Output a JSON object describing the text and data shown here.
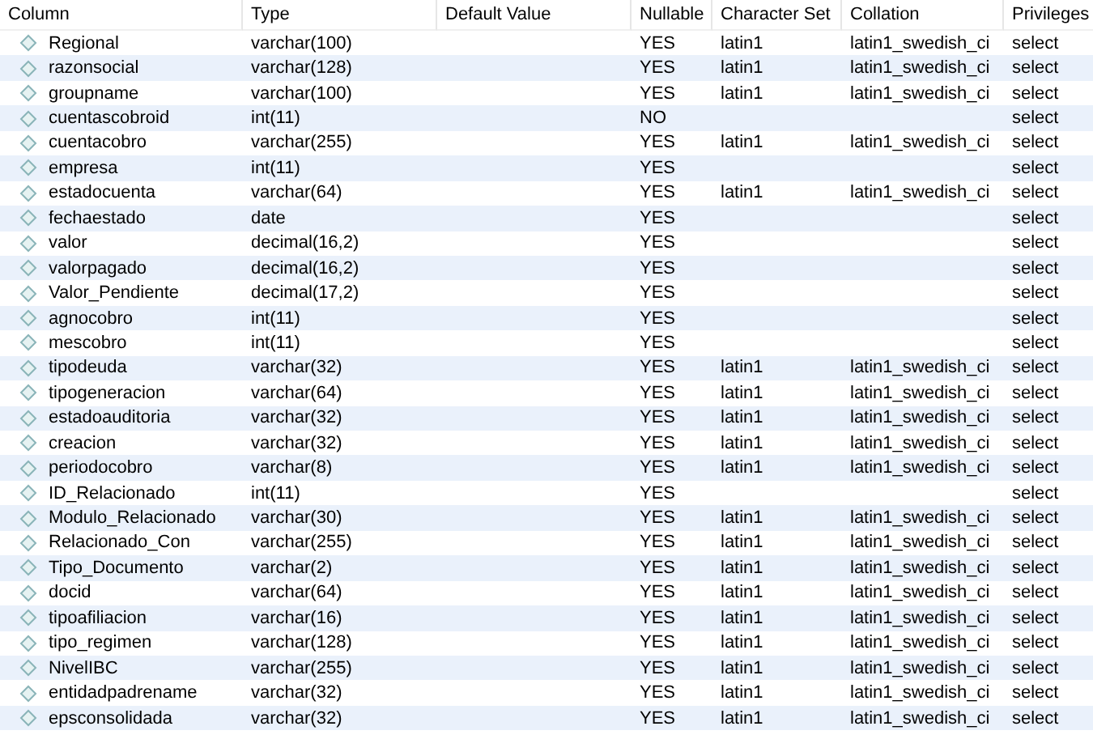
{
  "table": {
    "columns": [
      "Column",
      "Type",
      "Default Value",
      "Nullable",
      "Character Set",
      "Collation",
      "Privileges"
    ],
    "rows": [
      {
        "column": "Regional",
        "type": "varchar(100)",
        "nullable": "YES",
        "charset": "latin1",
        "collation": "latin1_swedish_ci",
        "privileges": "select"
      },
      {
        "column": "razonsocial",
        "type": "varchar(128)",
        "nullable": "YES",
        "charset": "latin1",
        "collation": "latin1_swedish_ci",
        "privileges": "select"
      },
      {
        "column": "groupname",
        "type": "varchar(100)",
        "nullable": "YES",
        "charset": "latin1",
        "collation": "latin1_swedish_ci",
        "privileges": "select"
      },
      {
        "column": "cuentascobroid",
        "type": "int(11)",
        "nullable": "NO",
        "privileges": "select"
      },
      {
        "column": "cuentacobro",
        "type": "varchar(255)",
        "nullable": "YES",
        "charset": "latin1",
        "collation": "latin1_swedish_ci",
        "privileges": "select"
      },
      {
        "column": "empresa",
        "type": "int(11)",
        "nullable": "YES",
        "privileges": "select"
      },
      {
        "column": "estadocuenta",
        "type": "varchar(64)",
        "nullable": "YES",
        "charset": "latin1",
        "collation": "latin1_swedish_ci",
        "privileges": "select"
      },
      {
        "column": "fechaestado",
        "type": "date",
        "nullable": "YES",
        "privileges": "select"
      },
      {
        "column": "valor",
        "type": "decimal(16,2)",
        "nullable": "YES",
        "privileges": "select"
      },
      {
        "column": "valorpagado",
        "type": "decimal(16,2)",
        "nullable": "YES",
        "privileges": "select"
      },
      {
        "column": "Valor_Pendiente",
        "type": "decimal(17,2)",
        "nullable": "YES",
        "privileges": "select"
      },
      {
        "column": "agnocobro",
        "type": "int(11)",
        "nullable": "YES",
        "privileges": "select"
      },
      {
        "column": "mescobro",
        "type": "int(11)",
        "nullable": "YES",
        "privileges": "select"
      },
      {
        "column": "tipodeuda",
        "type": "varchar(32)",
        "nullable": "YES",
        "charset": "latin1",
        "collation": "latin1_swedish_ci",
        "privileges": "select"
      },
      {
        "column": "tipogeneracion",
        "type": "varchar(64)",
        "nullable": "YES",
        "charset": "latin1",
        "collation": "latin1_swedish_ci",
        "privileges": "select"
      },
      {
        "column": "estadoauditoria",
        "type": "varchar(32)",
        "nullable": "YES",
        "charset": "latin1",
        "collation": "latin1_swedish_ci",
        "privileges": "select"
      },
      {
        "column": "creacion",
        "type": "varchar(32)",
        "nullable": "YES",
        "charset": "latin1",
        "collation": "latin1_swedish_ci",
        "privileges": "select"
      },
      {
        "column": "periodocobro",
        "type": "varchar(8)",
        "nullable": "YES",
        "charset": "latin1",
        "collation": "latin1_swedish_ci",
        "privileges": "select"
      },
      {
        "column": "ID_Relacionado",
        "type": "int(11)",
        "nullable": "YES",
        "privileges": "select"
      },
      {
        "column": "Modulo_Relacionado",
        "type": "varchar(30)",
        "nullable": "YES",
        "charset": "latin1",
        "collation": "latin1_swedish_ci",
        "privileges": "select"
      },
      {
        "column": "Relacionado_Con",
        "type": "varchar(255)",
        "nullable": "YES",
        "charset": "latin1",
        "collation": "latin1_swedish_ci",
        "privileges": "select"
      },
      {
        "column": "Tipo_Documento",
        "type": "varchar(2)",
        "nullable": "YES",
        "charset": "latin1",
        "collation": "latin1_swedish_ci",
        "privileges": "select"
      },
      {
        "column": "docid",
        "type": "varchar(64)",
        "nullable": "YES",
        "charset": "latin1",
        "collation": "latin1_swedish_ci",
        "privileges": "select"
      },
      {
        "column": "tipoafiliacion",
        "type": "varchar(16)",
        "nullable": "YES",
        "charset": "latin1",
        "collation": "latin1_swedish_ci",
        "privileges": "select"
      },
      {
        "column": "tipo_regimen",
        "type": "varchar(128)",
        "nullable": "YES",
        "charset": "latin1",
        "collation": "latin1_swedish_ci",
        "privileges": "select"
      },
      {
        "column": "NivelIBC",
        "type": "varchar(255)",
        "nullable": "YES",
        "charset": "latin1",
        "collation": "latin1_swedish_ci",
        "privileges": "select"
      },
      {
        "column": "entidadpadrename",
        "type": "varchar(32)",
        "nullable": "YES",
        "charset": "latin1",
        "collation": "latin1_swedish_ci",
        "privileges": "select"
      },
      {
        "column": "epsconsolidada",
        "type": "varchar(32)",
        "nullable": "YES",
        "charset": "latin1",
        "collation": "latin1_swedish_ci",
        "privileges": "select"
      }
    ]
  }
}
